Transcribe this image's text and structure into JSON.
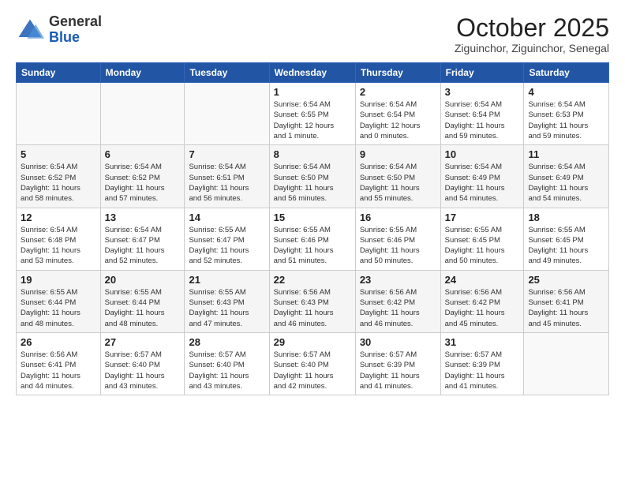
{
  "header": {
    "logo": {
      "general": "General",
      "blue": "Blue"
    },
    "title": "October 2025",
    "subtitle": "Ziguinchor, Ziguinchor, Senegal"
  },
  "weekdays": [
    "Sunday",
    "Monday",
    "Tuesday",
    "Wednesday",
    "Thursday",
    "Friday",
    "Saturday"
  ],
  "weeks": [
    [
      {
        "day": "",
        "info": ""
      },
      {
        "day": "",
        "info": ""
      },
      {
        "day": "",
        "info": ""
      },
      {
        "day": "1",
        "info": "Sunrise: 6:54 AM\nSunset: 6:55 PM\nDaylight: 12 hours\nand 1 minute."
      },
      {
        "day": "2",
        "info": "Sunrise: 6:54 AM\nSunset: 6:54 PM\nDaylight: 12 hours\nand 0 minutes."
      },
      {
        "day": "3",
        "info": "Sunrise: 6:54 AM\nSunset: 6:54 PM\nDaylight: 11 hours\nand 59 minutes."
      },
      {
        "day": "4",
        "info": "Sunrise: 6:54 AM\nSunset: 6:53 PM\nDaylight: 11 hours\nand 59 minutes."
      }
    ],
    [
      {
        "day": "5",
        "info": "Sunrise: 6:54 AM\nSunset: 6:52 PM\nDaylight: 11 hours\nand 58 minutes."
      },
      {
        "day": "6",
        "info": "Sunrise: 6:54 AM\nSunset: 6:52 PM\nDaylight: 11 hours\nand 57 minutes."
      },
      {
        "day": "7",
        "info": "Sunrise: 6:54 AM\nSunset: 6:51 PM\nDaylight: 11 hours\nand 56 minutes."
      },
      {
        "day": "8",
        "info": "Sunrise: 6:54 AM\nSunset: 6:50 PM\nDaylight: 11 hours\nand 56 minutes."
      },
      {
        "day": "9",
        "info": "Sunrise: 6:54 AM\nSunset: 6:50 PM\nDaylight: 11 hours\nand 55 minutes."
      },
      {
        "day": "10",
        "info": "Sunrise: 6:54 AM\nSunset: 6:49 PM\nDaylight: 11 hours\nand 54 minutes."
      },
      {
        "day": "11",
        "info": "Sunrise: 6:54 AM\nSunset: 6:49 PM\nDaylight: 11 hours\nand 54 minutes."
      }
    ],
    [
      {
        "day": "12",
        "info": "Sunrise: 6:54 AM\nSunset: 6:48 PM\nDaylight: 11 hours\nand 53 minutes."
      },
      {
        "day": "13",
        "info": "Sunrise: 6:54 AM\nSunset: 6:47 PM\nDaylight: 11 hours\nand 52 minutes."
      },
      {
        "day": "14",
        "info": "Sunrise: 6:55 AM\nSunset: 6:47 PM\nDaylight: 11 hours\nand 52 minutes."
      },
      {
        "day": "15",
        "info": "Sunrise: 6:55 AM\nSunset: 6:46 PM\nDaylight: 11 hours\nand 51 minutes."
      },
      {
        "day": "16",
        "info": "Sunrise: 6:55 AM\nSunset: 6:46 PM\nDaylight: 11 hours\nand 50 minutes."
      },
      {
        "day": "17",
        "info": "Sunrise: 6:55 AM\nSunset: 6:45 PM\nDaylight: 11 hours\nand 50 minutes."
      },
      {
        "day": "18",
        "info": "Sunrise: 6:55 AM\nSunset: 6:45 PM\nDaylight: 11 hours\nand 49 minutes."
      }
    ],
    [
      {
        "day": "19",
        "info": "Sunrise: 6:55 AM\nSunset: 6:44 PM\nDaylight: 11 hours\nand 48 minutes."
      },
      {
        "day": "20",
        "info": "Sunrise: 6:55 AM\nSunset: 6:44 PM\nDaylight: 11 hours\nand 48 minutes."
      },
      {
        "day": "21",
        "info": "Sunrise: 6:55 AM\nSunset: 6:43 PM\nDaylight: 11 hours\nand 47 minutes."
      },
      {
        "day": "22",
        "info": "Sunrise: 6:56 AM\nSunset: 6:43 PM\nDaylight: 11 hours\nand 46 minutes."
      },
      {
        "day": "23",
        "info": "Sunrise: 6:56 AM\nSunset: 6:42 PM\nDaylight: 11 hours\nand 46 minutes."
      },
      {
        "day": "24",
        "info": "Sunrise: 6:56 AM\nSunset: 6:42 PM\nDaylight: 11 hours\nand 45 minutes."
      },
      {
        "day": "25",
        "info": "Sunrise: 6:56 AM\nSunset: 6:41 PM\nDaylight: 11 hours\nand 45 minutes."
      }
    ],
    [
      {
        "day": "26",
        "info": "Sunrise: 6:56 AM\nSunset: 6:41 PM\nDaylight: 11 hours\nand 44 minutes."
      },
      {
        "day": "27",
        "info": "Sunrise: 6:57 AM\nSunset: 6:40 PM\nDaylight: 11 hours\nand 43 minutes."
      },
      {
        "day": "28",
        "info": "Sunrise: 6:57 AM\nSunset: 6:40 PM\nDaylight: 11 hours\nand 43 minutes."
      },
      {
        "day": "29",
        "info": "Sunrise: 6:57 AM\nSunset: 6:40 PM\nDaylight: 11 hours\nand 42 minutes."
      },
      {
        "day": "30",
        "info": "Sunrise: 6:57 AM\nSunset: 6:39 PM\nDaylight: 11 hours\nand 41 minutes."
      },
      {
        "day": "31",
        "info": "Sunrise: 6:57 AM\nSunset: 6:39 PM\nDaylight: 11 hours\nand 41 minutes."
      },
      {
        "day": "",
        "info": ""
      }
    ]
  ]
}
